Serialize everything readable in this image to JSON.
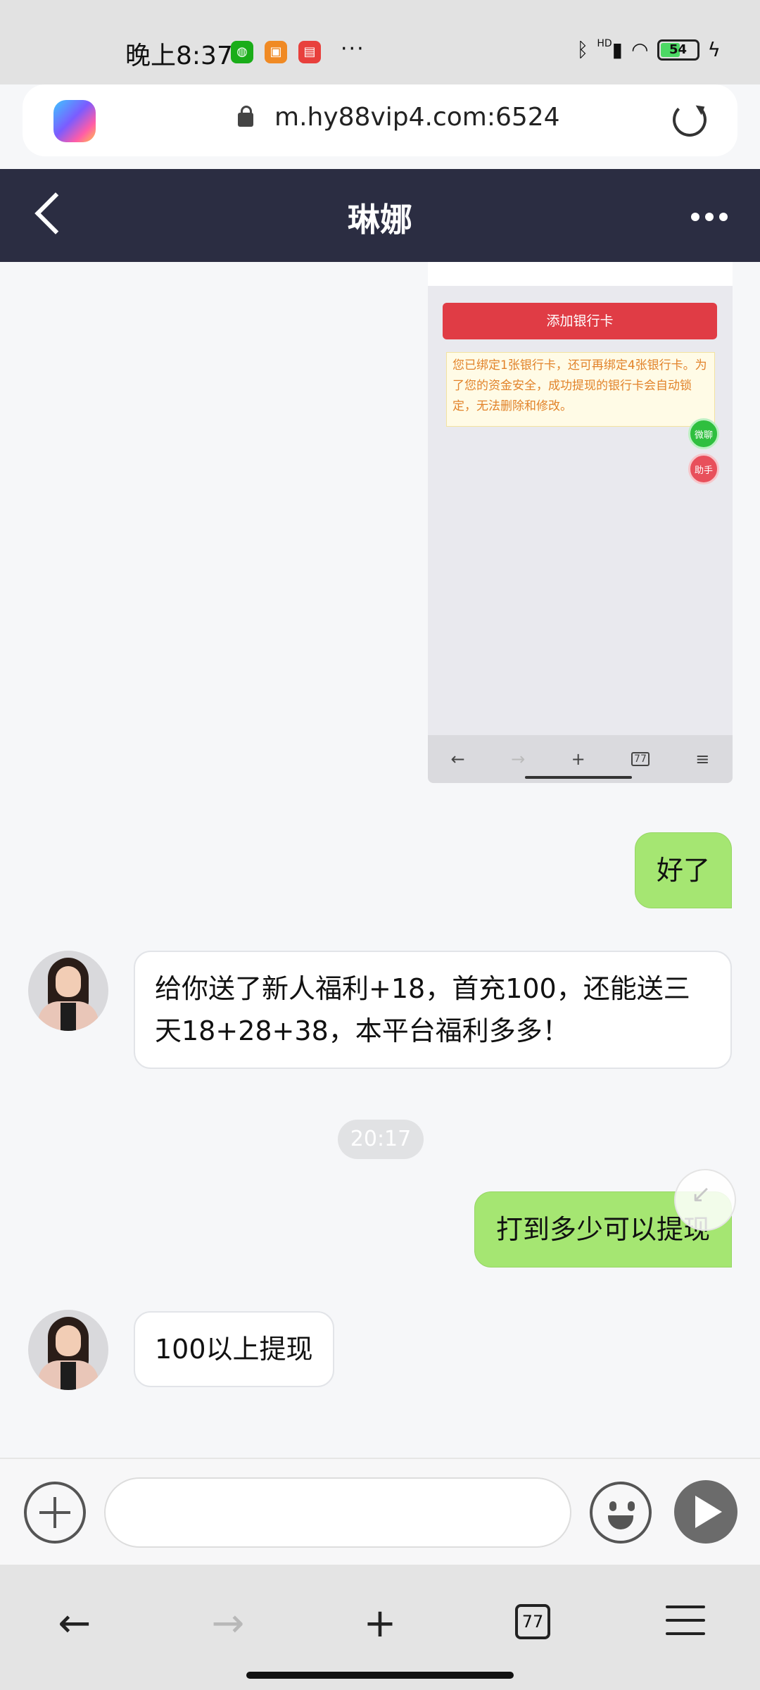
{
  "status_bar": {
    "time": "晚上8:37",
    "more": "···",
    "network": "HD",
    "battery": "54"
  },
  "browser": {
    "url": "m.hy88vip4.com:6524",
    "tabs_count": "77"
  },
  "chat": {
    "title": "琳娜"
  },
  "screenshot": {
    "add_card_label": "添加银行卡",
    "notice": "您已绑定1张银行卡，还可再绑定4张银行卡。为了您的资金安全，成功提现的银行卡会自动锁定，无法删除和修改。",
    "chat_bubble": "微聊",
    "assistant_bubble": "助手"
  },
  "messages": [
    {
      "from": "me",
      "text": "好了"
    },
    {
      "from": "other",
      "text": "给你送了新人福利+18，首充100，还能送三天18+28+38，本平台福利多多！"
    },
    {
      "from": "time",
      "text": "20:17"
    },
    {
      "from": "me",
      "text": "打到多少可以提现"
    },
    {
      "from": "other",
      "text": "100以上提现"
    }
  ],
  "input": {
    "value": "",
    "placeholder": ""
  },
  "colors": {
    "header_bg": "#2b2d42",
    "my_bubble": "#a5e672",
    "add_card_button": "#e03c45"
  }
}
